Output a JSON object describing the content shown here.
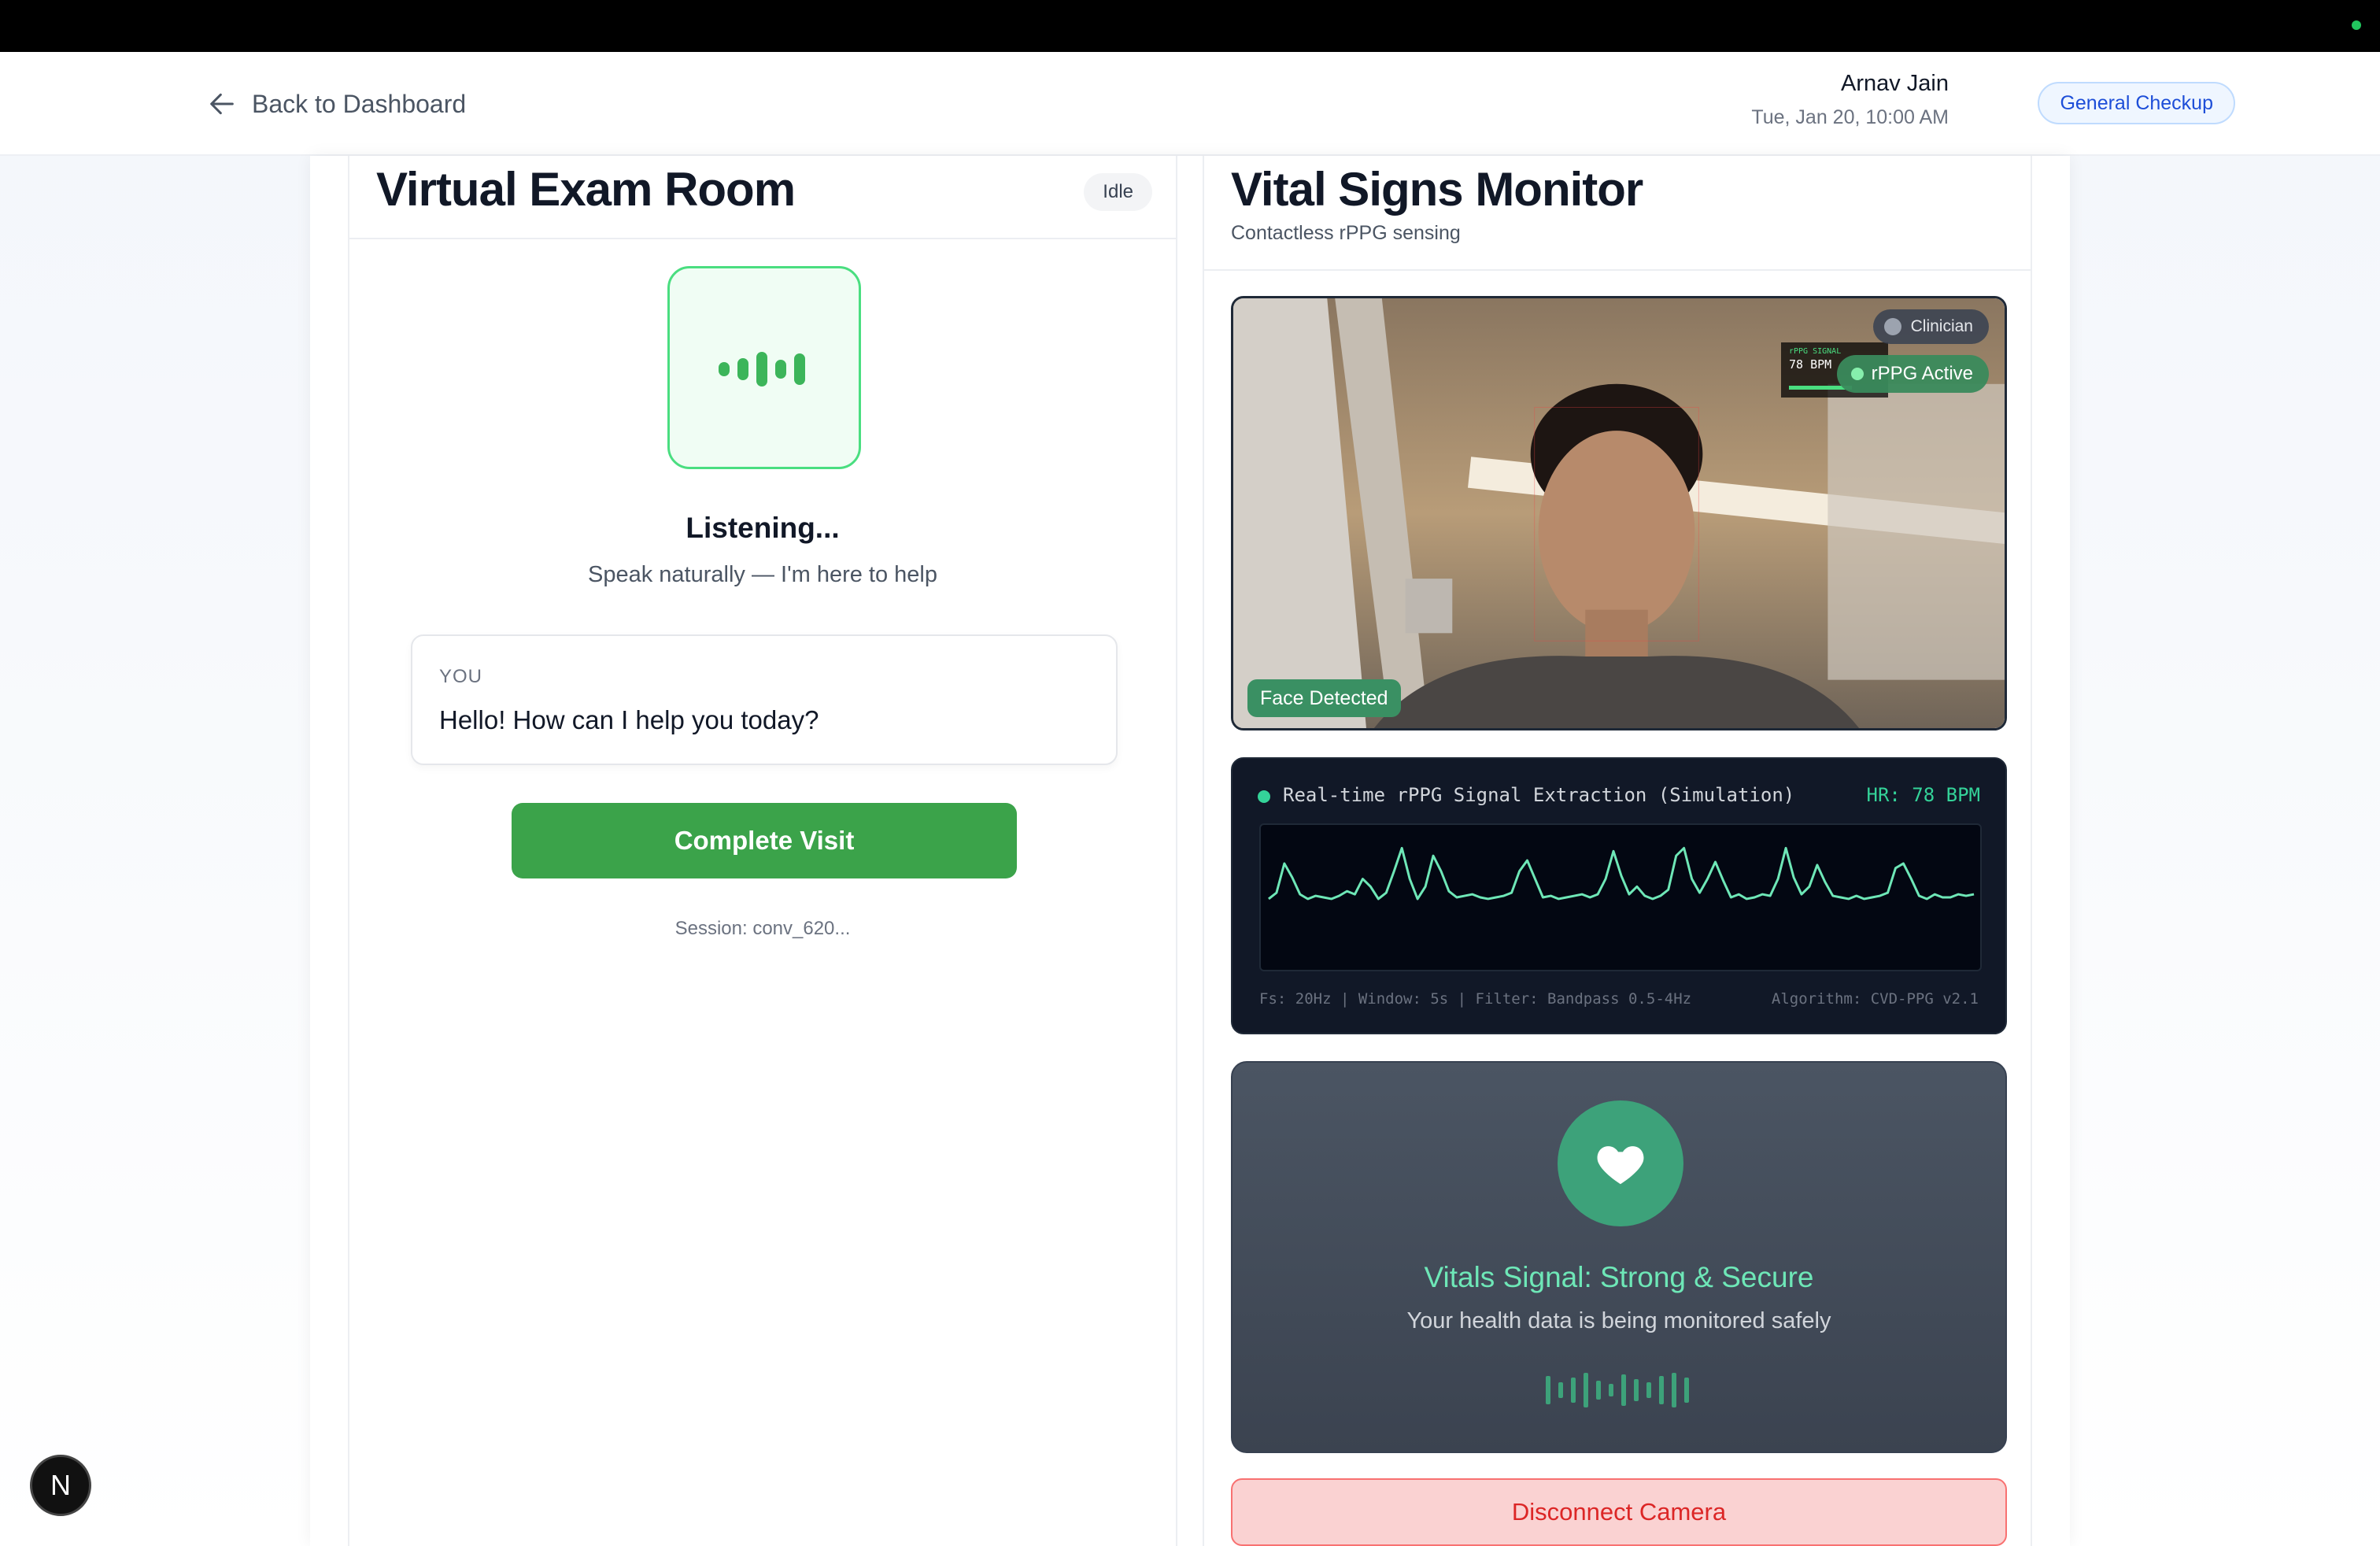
{
  "header": {
    "back_label": "Back to Dashboard",
    "patient_name": "Arnav Jain",
    "appointment_time": "Tue, Jan 20, 10:00 AM",
    "visit_type": "General Checkup"
  },
  "exam_room": {
    "title": "Virtual Exam Room",
    "status": "Idle",
    "listening_title": "Listening...",
    "listening_subtitle": "Speak naturally — I'm here to help",
    "message_sender": "YOU",
    "message_text": "Hello! How can I help you today?",
    "complete_button": "Complete Visit",
    "session": "Session: conv_620..."
  },
  "vitals_monitor": {
    "title": "Vital Signs Monitor",
    "subtitle": "Contactless rPPG sensing",
    "camera": {
      "clinician_label": "Clinician",
      "rppg_label": "rPPG Active",
      "overlay_signal_label": "rPPG SIGNAL",
      "overlay_bpm": "78 BPM",
      "face_label": "Face Detected"
    },
    "signal": {
      "title": "Real-time rPPG Signal Extraction (Simulation)",
      "hr": "HR: 78 BPM",
      "params": "Fs: 20Hz | Window: 5s | Filter: Bandpass 0.5-4Hz",
      "algorithm": "Algorithm: CVD-PPG v2.1"
    },
    "status": {
      "title": "Vitals Signal: Strong & Secure",
      "subtitle": "Your health data is being monitored safely"
    },
    "disconnect_button": "Disconnect Camera"
  },
  "dev_badge": "N",
  "colors": {
    "accent_green": "#3ba34a",
    "signal_green": "#34d399",
    "visit_badge_blue": "#1d4ed8",
    "danger_red": "#dc2626"
  }
}
